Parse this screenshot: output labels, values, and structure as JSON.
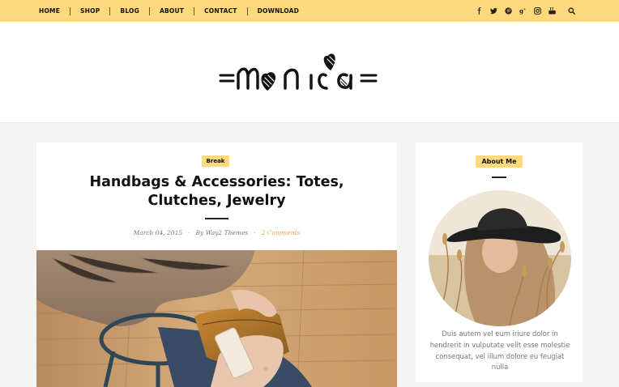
{
  "nav": {
    "items": [
      "HOME",
      "SHOP",
      "BLOG",
      "ABOUT",
      "CONTACT",
      "DOWNLOAD"
    ]
  },
  "social_icons": [
    "facebook-icon",
    "twitter-icon",
    "pinterest-icon",
    "google-plus-icon",
    "instagram-icon",
    "youtube-icon",
    "search-icon"
  ],
  "site": {
    "logo_text": "monica"
  },
  "post": {
    "category": "Break",
    "title": "Handbags & Accessories: Totes, Clutches, Jewelry",
    "date": "March 04, 2015",
    "author": "By Way2 Themes",
    "comments": "2 Comments"
  },
  "sidebar": {
    "widget_title": "About Me",
    "about_text": "Duis autem vel eum iriure dolor in hendrerit in vulputate velit esse molestie consequat, vel illum dolore eu feugiat nulla"
  },
  "colors": {
    "accent": "#ffd97c",
    "link": "#f0a93b",
    "background": "#f4f4f4"
  }
}
